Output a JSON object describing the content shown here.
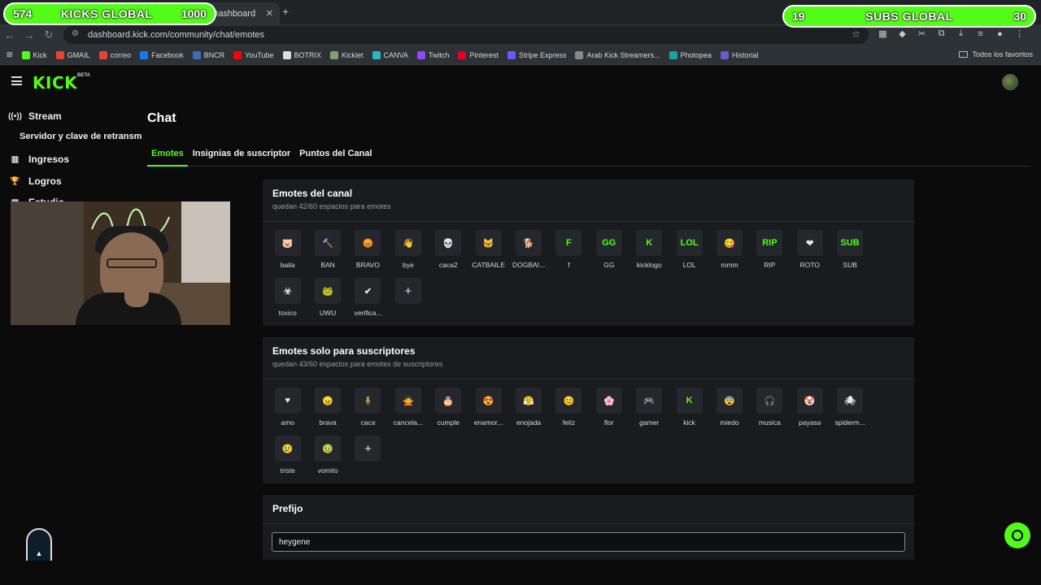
{
  "browser": {
    "tab_title": "Emotes | Dashboard",
    "url": "dashboard.kick.com/community/chat/emotes",
    "bookmarks": [
      {
        "label": "Kick",
        "color": "#53fc18"
      },
      {
        "label": "GMAIL",
        "color": "#ea4335"
      },
      {
        "label": "correo",
        "color": "#ea4335"
      },
      {
        "label": "Facebook",
        "color": "#1877f2"
      },
      {
        "label": "BNCR",
        "color": "#3a6db5"
      },
      {
        "label": "YouTube",
        "color": "#ff0000"
      },
      {
        "label": "BOTRIX",
        "color": "#dddddd"
      },
      {
        "label": "Kicklet",
        "color": "#7fa06e"
      },
      {
        "label": "CANVA",
        "color": "#2bb5c9"
      },
      {
        "label": "Twitch",
        "color": "#9146ff"
      },
      {
        "label": "Pinterest",
        "color": "#e60023"
      },
      {
        "label": "Stripe Express",
        "color": "#635bff"
      },
      {
        "label": "Arab Kick Streamers...",
        "color": "#888888"
      },
      {
        "label": "Photopea",
        "color": "#18a497"
      },
      {
        "label": "Historial",
        "color": "#6a5acd"
      }
    ],
    "all_bookmarks": "Todos los favoritos"
  },
  "overlay": {
    "left": {
      "value": "574",
      "label": "KICKS GLOBAL",
      "goal": "1000"
    },
    "right": {
      "value": "19",
      "label": "SUBS GLOBAL",
      "goal": "30"
    }
  },
  "header": {
    "logo": "KICK",
    "beta": "BETA"
  },
  "sidebar": {
    "stream": "Stream",
    "stream_sub": "Servidor y clave de retransm",
    "ingresos": "Ingresos",
    "logros": "Logros",
    "estudio": "Estudio"
  },
  "main": {
    "title": "Chat",
    "tabs": [
      "Emotes",
      "Insignias de suscriptor",
      "Puntos del Canal"
    ],
    "channel_emotes": {
      "title": "Emotes del canal",
      "subtitle": "quedan 42/60 espacios para emotes",
      "items": [
        {
          "name": "baila",
          "glyph": "🐷",
          "bg": "#24272c"
        },
        {
          "name": "BAN",
          "glyph": "🔨",
          "bg": "#24272c"
        },
        {
          "name": "BRAVO",
          "glyph": "😡",
          "bg": "#24272c"
        },
        {
          "name": "bye",
          "glyph": "👋",
          "bg": "#24272c"
        },
        {
          "name": "caca2",
          "glyph": "💀",
          "bg": "#24272c"
        },
        {
          "name": "CATBAILE",
          "glyph": "🐱",
          "bg": "#24272c"
        },
        {
          "name": "DOGBAI...",
          "glyph": "🐕",
          "bg": "#24272c"
        },
        {
          "name": "f",
          "glyph": "F",
          "bg": "#24272c"
        },
        {
          "name": "GG",
          "glyph": "GG",
          "bg": "#24272c"
        },
        {
          "name": "kicklogo",
          "glyph": "K",
          "bg": "#24272c"
        },
        {
          "name": "LOL",
          "glyph": "LOL",
          "bg": "#24272c"
        },
        {
          "name": "mmm",
          "glyph": "😋",
          "bg": "#24272c"
        },
        {
          "name": "RIP",
          "glyph": "RIP",
          "bg": "#24272c"
        },
        {
          "name": "ROTO",
          "glyph": "❤",
          "bg": "#24272c"
        },
        {
          "name": "SUB",
          "glyph": "SUB",
          "bg": "#24272c"
        },
        {
          "name": "toxico",
          "glyph": "☣",
          "bg": "#24272c"
        },
        {
          "name": "UWU",
          "glyph": "🐸",
          "bg": "#24272c"
        },
        {
          "name": "verifica...",
          "glyph": "✔",
          "bg": "#24272c"
        }
      ]
    },
    "sub_emotes": {
      "title": "Emotes solo para suscriptores",
      "subtitle": "quedan 43/60 espacios para emotes de suscriptores",
      "items": [
        {
          "name": "amo",
          "glyph": "♥",
          "bg": "#24272c"
        },
        {
          "name": "brava",
          "glyph": "😠",
          "bg": "#24272c"
        },
        {
          "name": "caca",
          "glyph": "🧍",
          "bg": "#24272c"
        },
        {
          "name": "cancela...",
          "glyph": "🙅",
          "bg": "#24272c"
        },
        {
          "name": "cumple",
          "glyph": "🎂",
          "bg": "#24272c"
        },
        {
          "name": "enamor...",
          "glyph": "😍",
          "bg": "#24272c"
        },
        {
          "name": "enojada",
          "glyph": "😤",
          "bg": "#24272c"
        },
        {
          "name": "feliz",
          "glyph": "😊",
          "bg": "#24272c"
        },
        {
          "name": "flor",
          "glyph": "🌸",
          "bg": "#24272c"
        },
        {
          "name": "gamer",
          "glyph": "🎮",
          "bg": "#24272c"
        },
        {
          "name": "kick",
          "glyph": "K",
          "bg": "#24272c"
        },
        {
          "name": "miedo",
          "glyph": "😨",
          "bg": "#24272c"
        },
        {
          "name": "musica",
          "glyph": "🎧",
          "bg": "#24272c"
        },
        {
          "name": "payasa",
          "glyph": "🤡",
          "bg": "#24272c"
        },
        {
          "name": "spiderm...",
          "glyph": "🕷",
          "bg": "#24272c"
        },
        {
          "name": "triste",
          "glyph": "😢",
          "bg": "#24272c"
        },
        {
          "name": "vomito",
          "glyph": "🤢",
          "bg": "#24272c"
        }
      ]
    },
    "prefix": {
      "title": "Prefijo",
      "value": "heygene"
    }
  },
  "colors": {
    "accent": "#53fc18",
    "card": "#191b1f",
    "background": "#0b0b0b"
  }
}
